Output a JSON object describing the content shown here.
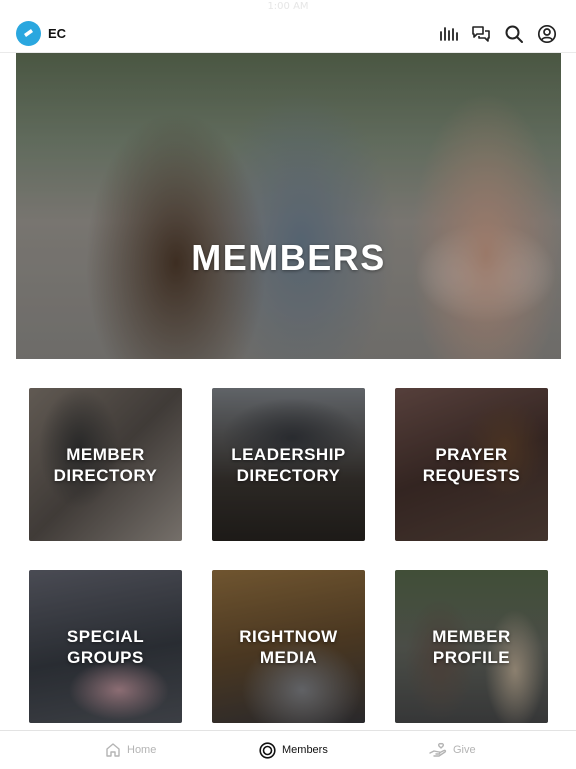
{
  "status_bar": {
    "time": "1:00 AM"
  },
  "header": {
    "app_initials": "EC"
  },
  "hero": {
    "title": "MEMBERS"
  },
  "tiles": [
    {
      "line1": "MEMBER",
      "line2": "DIRECTORY"
    },
    {
      "line1": "LEADERSHIP",
      "line2": "DIRECTORY"
    },
    {
      "line1": "PRAYER",
      "line2": "REQUESTS"
    },
    {
      "line1": "SPECIAL",
      "line2": "GROUPS"
    },
    {
      "line1": "RIGHTNOW",
      "line2": "MEDIA"
    },
    {
      "line1": "MEMBER",
      "line2": "PROFILE"
    }
  ],
  "tab_bar": {
    "home_label": "Home",
    "members_label": "Members",
    "give_label": "Give"
  },
  "colors": {
    "brand": "#2aa7df",
    "active_tab": "#111111",
    "inactive_tab": "#b4b4b4"
  },
  "icons": [
    "audio-bars-icon",
    "chat-icon",
    "search-icon",
    "profile-icon",
    "home-icon",
    "members-icon",
    "give-icon"
  ]
}
